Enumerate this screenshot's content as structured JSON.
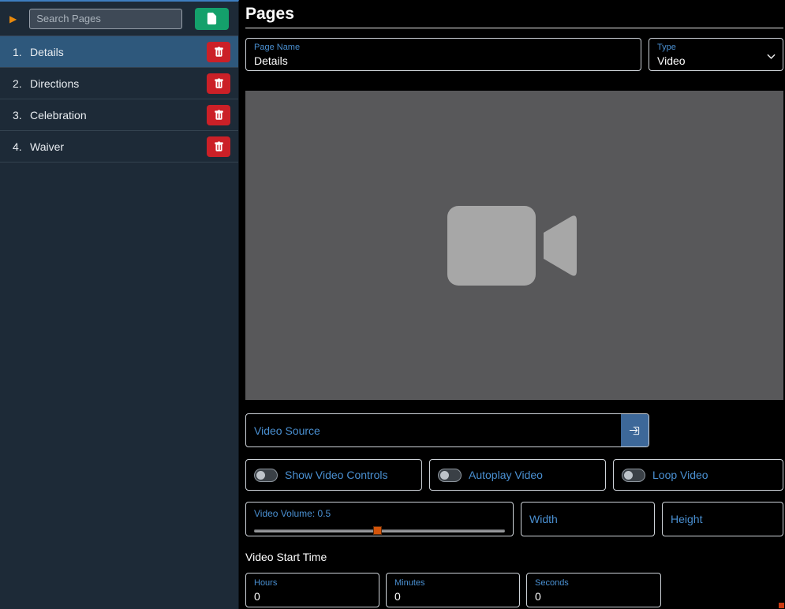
{
  "colors": {
    "accent_blue": "#4a90d2",
    "selected_row": "#2e587c",
    "danger_red": "#cb2027",
    "success_green": "#14a06b",
    "arrow_orange": "#e8890c",
    "slider_handle_orange": "#d4540a",
    "sidebar_bg": "#1d2a37",
    "video_placeholder_bg": "#58585a"
  },
  "sidebar": {
    "search_placeholder": "Search Pages",
    "items": [
      {
        "number": "1.",
        "label": "Details",
        "selected": true
      },
      {
        "number": "2.",
        "label": "Directions",
        "selected": false
      },
      {
        "number": "3.",
        "label": "Celebration",
        "selected": false
      },
      {
        "number": "4.",
        "label": "Waiver",
        "selected": false
      }
    ]
  },
  "main": {
    "title": "Pages",
    "page_name": {
      "label": "Page Name",
      "value": "Details"
    },
    "type": {
      "label": "Type",
      "value": "Video"
    },
    "video_source": {
      "label": "Video Source"
    },
    "toggles": [
      {
        "label": "Show Video Controls",
        "state": "off"
      },
      {
        "label": "Autoplay Video",
        "state": "off"
      },
      {
        "label": "Loop Video",
        "state": "off"
      }
    ],
    "volume": {
      "label": "Video Volume:",
      "value": "0.5"
    },
    "width_field": {
      "label": "Width"
    },
    "height_field": {
      "label": "Height"
    },
    "start_time": {
      "heading": "Video Start Time",
      "hours": {
        "label": "Hours",
        "value": "0"
      },
      "minutes": {
        "label": "Minutes",
        "value": "0"
      },
      "seconds": {
        "label": "Seconds",
        "value": "0"
      }
    }
  }
}
